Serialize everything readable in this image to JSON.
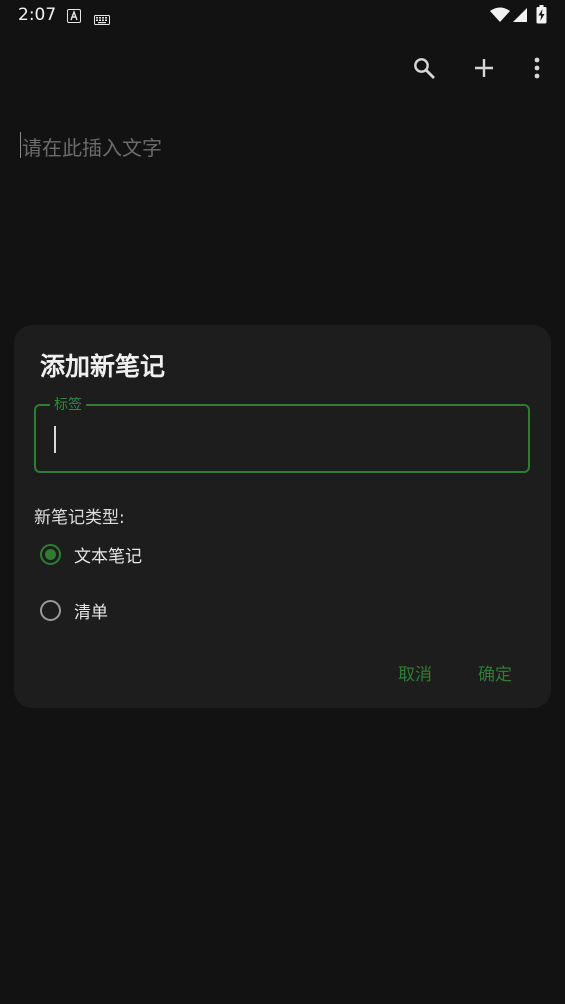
{
  "status_bar": {
    "time": "2:07",
    "icons": [
      "a-notification-icon",
      "keyboard-icon",
      "wifi-icon",
      "signal-icon",
      "battery-charging-icon"
    ]
  },
  "toolbar": {
    "icons": [
      "search-icon",
      "add-icon",
      "more-vert-icon"
    ]
  },
  "editor": {
    "placeholder": "请在此插入文字"
  },
  "dialog": {
    "title": "添加新笔记",
    "field": {
      "label": "标签",
      "value": ""
    },
    "type_label": "新笔记类型:",
    "options": [
      {
        "label": "文本笔记",
        "checked": true
      },
      {
        "label": "清单",
        "checked": false
      }
    ],
    "cancel_label": "取消",
    "confirm_label": "确定"
  },
  "colors": {
    "background": "#121212",
    "dialog": "#1d1d1d",
    "accent": "#2e7d32"
  }
}
